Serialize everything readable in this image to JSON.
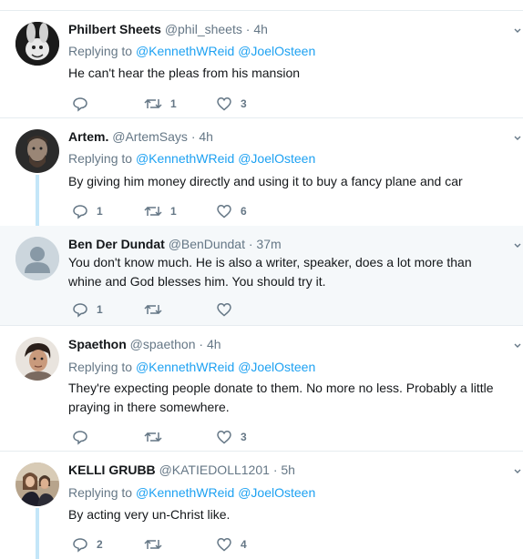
{
  "reply_prefix": "Replying to",
  "tweets": [
    {
      "name": "Philbert Sheets",
      "handle": "@phil_sheets",
      "dot": "·",
      "time": "4h",
      "reply_to": [
        "@KennethWReid",
        "@JoelOsteen"
      ],
      "text": "He can't hear the pleas from his mansion",
      "replies": "",
      "retweets": "1",
      "likes": "3"
    },
    {
      "name": "Artem.",
      "handle": "@ArtemSays",
      "dot": "·",
      "time": "4h",
      "reply_to": [
        "@KennethWReid",
        "@JoelOsteen"
      ],
      "text": "By giving him money directly and using it to buy a fancy plane and car",
      "replies": "1",
      "retweets": "1",
      "likes": "6"
    },
    {
      "name": "Ben Der Dundat",
      "handle": "@BenDundat",
      "dot": "·",
      "time": "37m",
      "text": "You don't know much.  He is also a writer, speaker, does a lot more than whine and God blesses him.  You should try it.",
      "replies": "1",
      "retweets": "",
      "likes": ""
    },
    {
      "name": "Spaethon",
      "handle": "@spaethon",
      "dot": "·",
      "time": "4h",
      "reply_to": [
        "@KennethWReid",
        "@JoelOsteen"
      ],
      "text": "They're expecting people donate to them. No more no less. Probably a little praying in there somewhere.",
      "replies": "",
      "retweets": "",
      "likes": "3"
    },
    {
      "name": "KELLI GRUBB",
      "handle": "@KATIEDOLL1201",
      "dot": "·",
      "time": "5h",
      "reply_to": [
        "@KennethWReid",
        "@JoelOsteen"
      ],
      "text": "By acting very un-Christ like.",
      "replies": "2",
      "retweets": "",
      "likes": "4"
    }
  ],
  "colors": {
    "link": "#1da1f2",
    "muted": "#657786",
    "thread": "#c4e6f8",
    "highlight": "#f5f8fa"
  },
  "icons": [
    "reply-icon",
    "retweet-icon",
    "like-icon",
    "chevron-down-icon"
  ]
}
